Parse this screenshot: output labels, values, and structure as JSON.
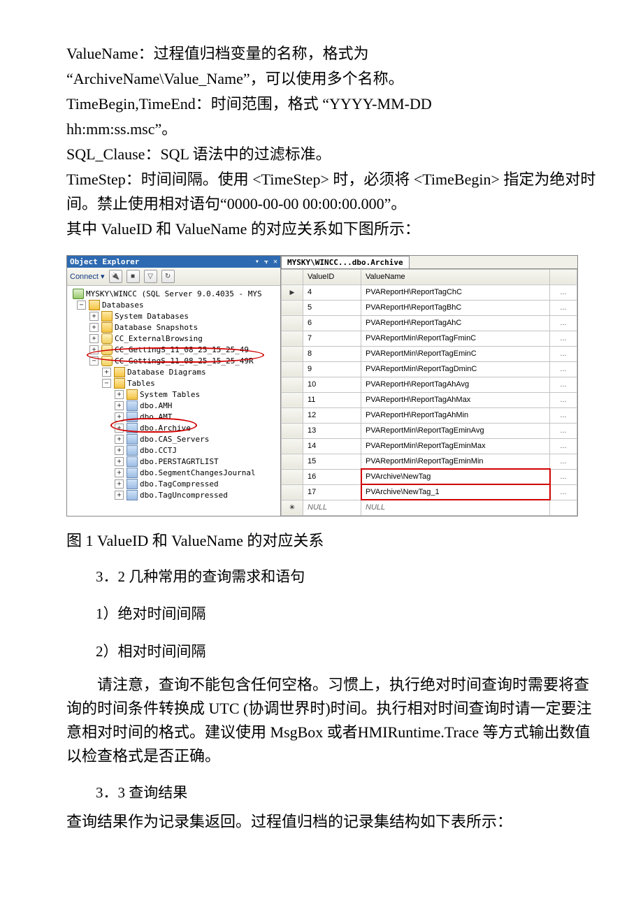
{
  "doc": {
    "p1": "ValueName：过程值归档变量的名称，格式为",
    "p2": "“ArchiveName\\Value_Name”，可以使用多个名称。",
    "p3": "TimeBegin,TimeEnd：时间范围，格式 “YYYY-MM-DD",
    "p4": "hh:mm:ss.msc”。",
    "p5": "SQL_Clause：SQL 语法中的过滤标准。",
    "p6": "TimeStep：时间间隔。使用 <TimeStep> 时，必须将 <TimeBegin> 指定为绝对时间。禁止使用相对语句“0000-00-00 00:00:00.000”。",
    "p7": "其中 ValueID 和 ValueName 的对应关系如下图所示："
  },
  "explorer": {
    "title": "Object Explorer",
    "ctrl_dropdown": "▾",
    "ctrl_pin": "⫟",
    "ctrl_close": "✕",
    "connect_label": "Connect ▾",
    "server_label": "MYSKY\\WINCC  (SQL Server 9.0.4035 - MYS"
  },
  "tree": {
    "databases": "Databases",
    "sys_db": "System Databases",
    "snapshots": "Database Snapshots",
    "cc_ext": "CC_ExternalBrowsing",
    "cc_gs1": "CC_GettingS_11_08_25_15_25_49",
    "cc_gs2": "CC_GettingS_11_08_25_15_25_49R",
    "db_diag": "Database Diagrams",
    "tables": "Tables",
    "sys_tables": "System Tables",
    "t_amh": "dbo.AMH",
    "t_amt": "dbo.AMT",
    "t_archive": "dbo.Archive",
    "t_cas": "dbo.CAS_Servers",
    "t_cctj": "dbo.CCTJ",
    "t_per": "dbo.PERSTAGRTLIST",
    "t_seg": "dbo.SegmentChangesJournal",
    "t_tc": "dbo.TagCompressed",
    "t_tu": "dbo.TagUncompressed"
  },
  "tab": {
    "label": "MYSKY\\WINCC...dbo.Archive"
  },
  "grid": {
    "col_id": "ValueID",
    "col_name": "ValueName",
    "rows": [
      {
        "id": "4",
        "name": "PVAReportH\\ReportTagChC",
        "hl": false
      },
      {
        "id": "5",
        "name": "PVAReportH\\ReportTagBhC",
        "hl": false
      },
      {
        "id": "6",
        "name": "PVAReportH\\ReportTagAhC",
        "hl": false
      },
      {
        "id": "7",
        "name": "PVAReportMin\\ReportTagFminC",
        "hl": false
      },
      {
        "id": "8",
        "name": "PVAReportMin\\ReportTagEminC",
        "hl": false
      },
      {
        "id": "9",
        "name": "PVAReportMin\\ReportTagDminC",
        "hl": false
      },
      {
        "id": "10",
        "name": "PVAReportH\\ReportTagAhAvg",
        "hl": false
      },
      {
        "id": "11",
        "name": "PVAReportH\\ReportTagAhMax",
        "hl": false
      },
      {
        "id": "12",
        "name": "PVAReportH\\ReportTagAhMin",
        "hl": false
      },
      {
        "id": "13",
        "name": "PVAReportMin\\ReportTagEminAvg",
        "hl": false
      },
      {
        "id": "14",
        "name": "PVAReportMin\\ReportTagEminMax",
        "hl": false
      },
      {
        "id": "15",
        "name": "PVAReportMin\\ReportTagEminMin",
        "hl": false
      },
      {
        "id": "16",
        "name": "PVArchive\\NewTag",
        "hl": true
      },
      {
        "id": "17",
        "name": "PVArchive\\NewTag_1",
        "hl": true
      }
    ],
    "null_label": "NULL",
    "el": "..."
  },
  "caption_fig1": "图 1 ValueID 和 ValueName 的对应关系",
  "sec32": "3．2 几种常用的查询需求和语句",
  "item1": "1）绝对时间间隔",
  "item2": "2）相对时间间隔",
  "note_para": "请注意，查询不能包含任何空格。习惯上，执行绝对时间查询时需要将查询的时间条件转换成 UTC (协调世界时)时间。执行相对时间查询时请一定要注意相对时间的格式。建议使用 MsgBox 或者HMIRuntime.Trace 等方式输出数值以检查格式是否正确。",
  "sec33": "3．3 查询结果",
  "sec33_p": "查询结果作为记录集返回。过程值归档的记录集结构如下表所示："
}
